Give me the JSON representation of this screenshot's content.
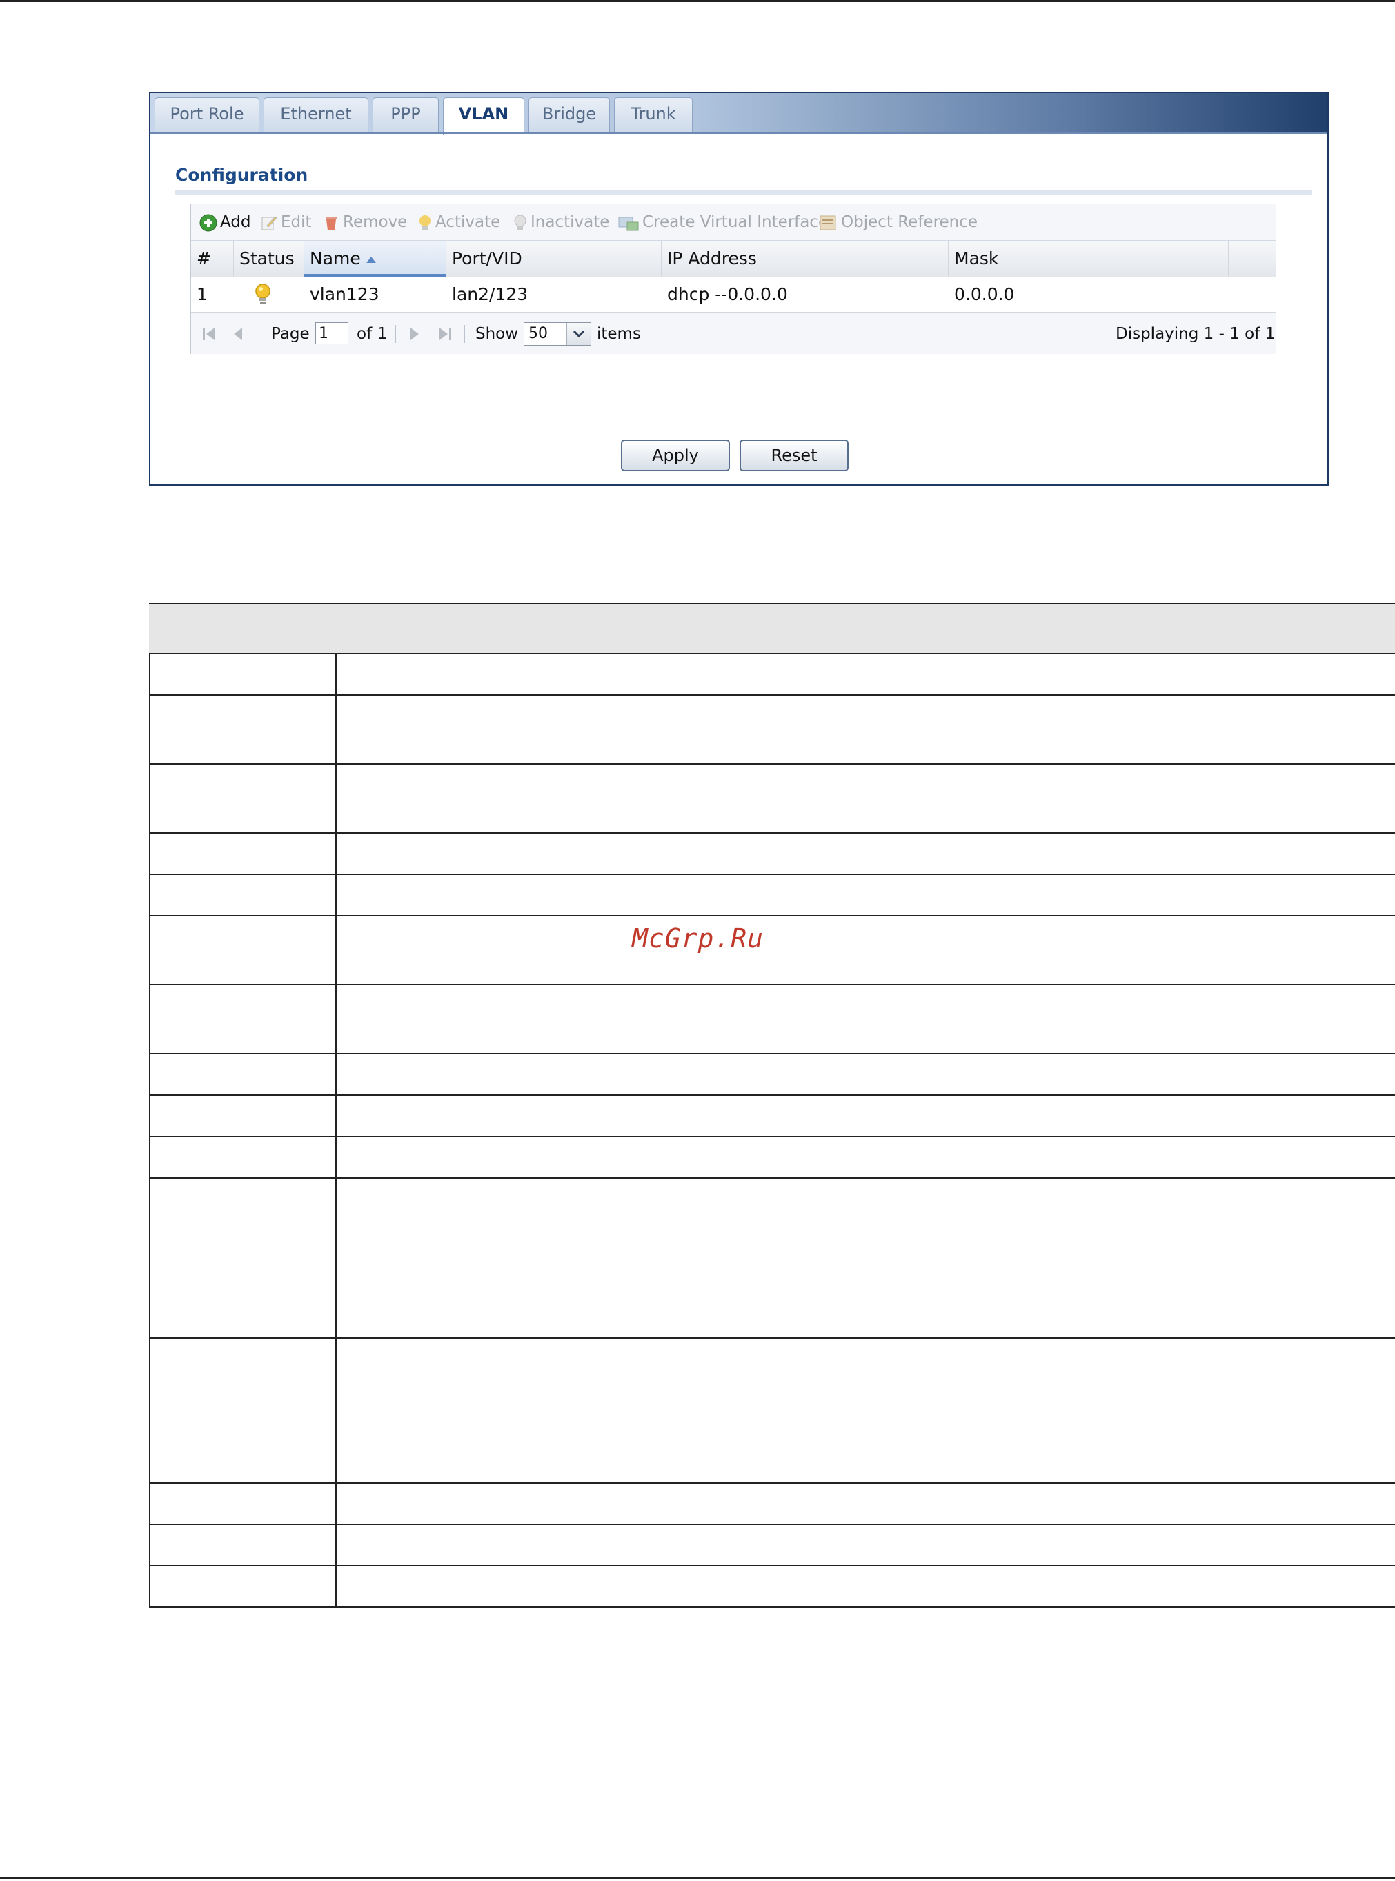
{
  "tabs": [
    "Port Role",
    "Ethernet",
    "PPP",
    "VLAN",
    "Bridge",
    "Trunk"
  ],
  "active_tab": "VLAN",
  "section_title": "Configuration",
  "toolbar": {
    "add": "Add",
    "edit": "Edit",
    "remove": "Remove",
    "activate": "Activate",
    "inactivate": "Inactivate",
    "create_virtual_interface": "Create Virtual Interface",
    "object_reference": "Object Reference"
  },
  "table": {
    "columns": [
      "#",
      "Status",
      "Name",
      "Port/VID",
      "IP Address",
      "Mask"
    ],
    "sorted_column": "Name",
    "rows": [
      {
        "num": "1",
        "status": "active",
        "name": "vlan123",
        "port_vid": "lan2/123",
        "ip": "dhcp --0.0.0.0",
        "mask": "0.0.0.0"
      }
    ]
  },
  "pager": {
    "page_label": "Page",
    "page_value": "1",
    "of_label": "of 1",
    "show_label": "Show",
    "show_value": "50",
    "items_label": "items",
    "displaying": "Displaying 1 - 1 of 1"
  },
  "buttons": {
    "apply": "Apply",
    "reset": "Reset"
  },
  "watermark": "McGrp.Ru",
  "colors": {
    "tab_bar_dark": "#203f6b",
    "title_blue": "#1c4a88",
    "sort_blue": "#5a86c4",
    "watermark_red": "#c0392b"
  }
}
